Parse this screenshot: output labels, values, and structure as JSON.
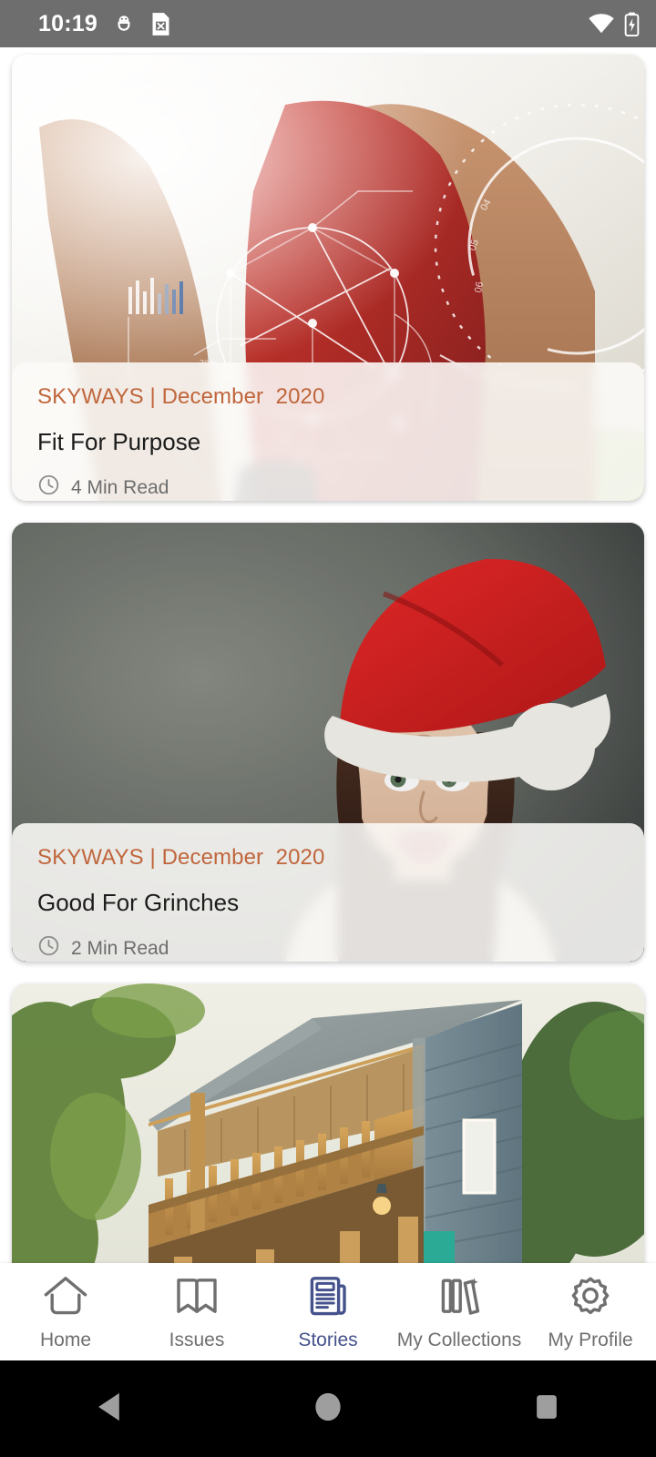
{
  "status_bar": {
    "time": "10:19",
    "left_icons": [
      "android-debug-icon",
      "no-sim-card-icon"
    ],
    "right_icons": [
      "wifi-icon",
      "battery-charging-icon"
    ],
    "background_color": "#6e6e6e",
    "foreground_color": "#ffffff"
  },
  "theme": {
    "accent_orange": "#c0663c",
    "active_tab_blue": "#45528c",
    "inactive_tab_gray": "#6f6f6f",
    "card_overlay": "#fcfbf8"
  },
  "stories": [
    {
      "kicker": "SKYWAYS | December  2020",
      "title": "Fit For Purpose",
      "read_time": "4 Min Read",
      "read_icon": "clock-icon",
      "image": "runner-fitness-tech-hud"
    },
    {
      "kicker": "SKYWAYS | December  2020",
      "title": "Good For Grinches",
      "read_time": "2 Min Read",
      "read_icon": "clock-icon",
      "image": "grumpy-woman-santa-hat"
    },
    {
      "kicker": "",
      "title": "",
      "read_time": "",
      "read_icon": "clock-icon",
      "image": "timber-house-verandah"
    }
  ],
  "tab_bar": {
    "active_index": 2,
    "items": [
      {
        "label": "Home",
        "icon": "home-icon"
      },
      {
        "label": "Issues",
        "icon": "bookmark-open-book-icon"
      },
      {
        "label": "Stories",
        "icon": "newspaper-document-icon"
      },
      {
        "label": "My Collections",
        "icon": "books-shelf-icon"
      },
      {
        "label": "My Profile",
        "icon": "gear-icon"
      }
    ]
  },
  "android_nav": {
    "buttons": [
      {
        "name": "back",
        "icon": "triangle-left-icon"
      },
      {
        "name": "home",
        "icon": "circle-icon"
      },
      {
        "name": "recents",
        "icon": "square-icon"
      }
    ],
    "background_color": "#000000",
    "icon_color": "#9e9e9e"
  }
}
